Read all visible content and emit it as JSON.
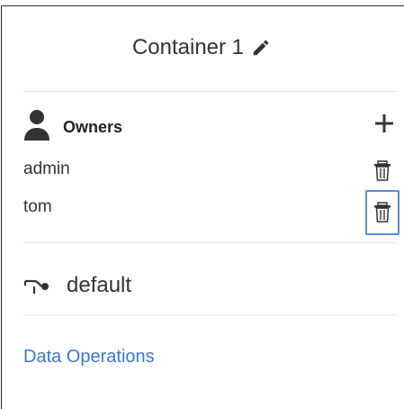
{
  "container": {
    "title": "Container 1"
  },
  "owners": {
    "heading": "Owners",
    "list": [
      {
        "name": "admin"
      },
      {
        "name": "tom"
      }
    ]
  },
  "dataset": {
    "label": "default"
  },
  "links": {
    "data_operations": "Data Operations"
  },
  "icons": {
    "edit": "pencil-icon",
    "user": "user-icon",
    "add": "plus-icon",
    "delete": "trash-icon",
    "connection": "connection-icon"
  },
  "colors": {
    "link": "#3b78c9",
    "focus_outline": "#5b8bd6",
    "text": "#333333"
  }
}
